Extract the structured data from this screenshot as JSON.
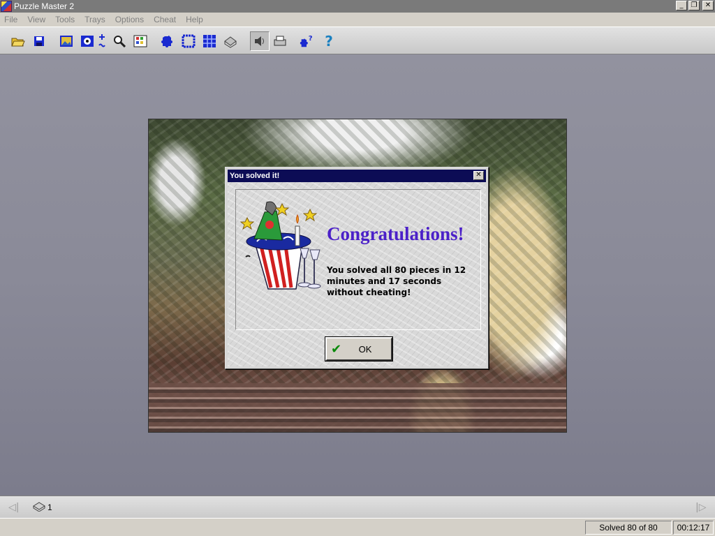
{
  "window": {
    "title": "Puzzle Master 2"
  },
  "window_buttons": {
    "minimize": "_",
    "restore": "❐",
    "close": "✕"
  },
  "menu": [
    "File",
    "View",
    "Tools",
    "Trays",
    "Options",
    "Cheat",
    "Help"
  ],
  "toolbar": {
    "icons": [
      "open-folder-icon",
      "save-icon",
      "picture-icon",
      "snapshot-icon",
      "add-remove-pieces-icon",
      "magnifier-icon",
      "grid-view-icon",
      "scatter-pieces-icon",
      "border-icon",
      "all-pieces-grid-icon",
      "tray-icon",
      "sound-icon",
      "print-icon",
      "puzzle-help-icon",
      "help-icon"
    ],
    "colors": {
      "accent": "#1a2ad0",
      "folder": "#e8c030"
    }
  },
  "dialog": {
    "title": "You solved it!",
    "close_glyph": "✕",
    "heading": "Congratulations!",
    "message": "You solved all 80 pieces in 12 minutes and 17 seconds without cheating!",
    "ok_label": "OK",
    "check_glyph": "✔",
    "heading_color": "#4b20c8"
  },
  "tray_bar": {
    "prev_arrow": "◁|",
    "next_arrow": "|▷",
    "tray_number": "1"
  },
  "status": {
    "solved": "Solved 80 of 80",
    "timer": "00:12:17"
  }
}
